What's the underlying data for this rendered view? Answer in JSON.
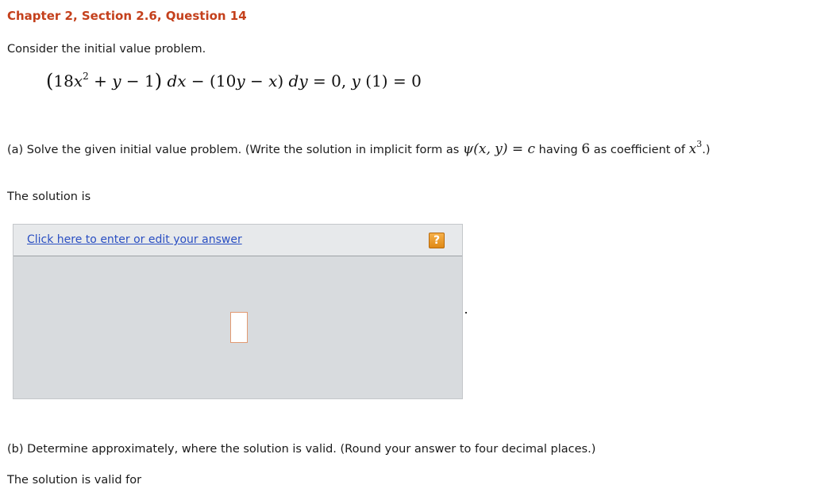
{
  "header": {
    "title": "Chapter 2, Section 2.6, Question 14"
  },
  "intro": {
    "text": "Consider the initial value problem."
  },
  "equation": {
    "open_paren": "(",
    "term1_coef": "18",
    "term1_var": "x",
    "term1_exp": "2",
    "plus": " + ",
    "y": "y",
    "minus_one": " − 1",
    "close_paren": ")",
    "dx": " dx",
    "minus": " − (10",
    "y2": "y",
    "minus_x": " − ",
    "x": "x",
    "close2": ")",
    "dy": " dy",
    "equals_zero": " = 0,  ",
    "y_ic": "y",
    "ic": " (1) = 0"
  },
  "part_a": {
    "text_before": "(a) Solve the given initial value problem. (Write the solution in implicit form as ",
    "psi": "ψ",
    "psi_args": "(x, y) = c",
    "text_mid": " having ",
    "six": "6",
    "text_after": " as coefficient of ",
    "x": "x",
    "exp": "3",
    "end": ".)"
  },
  "solution_label": "The solution is",
  "answer_box": {
    "link_text": "Click here to enter or edit your answer",
    "help_icon": "?"
  },
  "part_b": {
    "text": "(b) Determine approximately, where the solution is valid. (Round your answer to four decimal places.)"
  },
  "valid_label": "The solution is valid for"
}
